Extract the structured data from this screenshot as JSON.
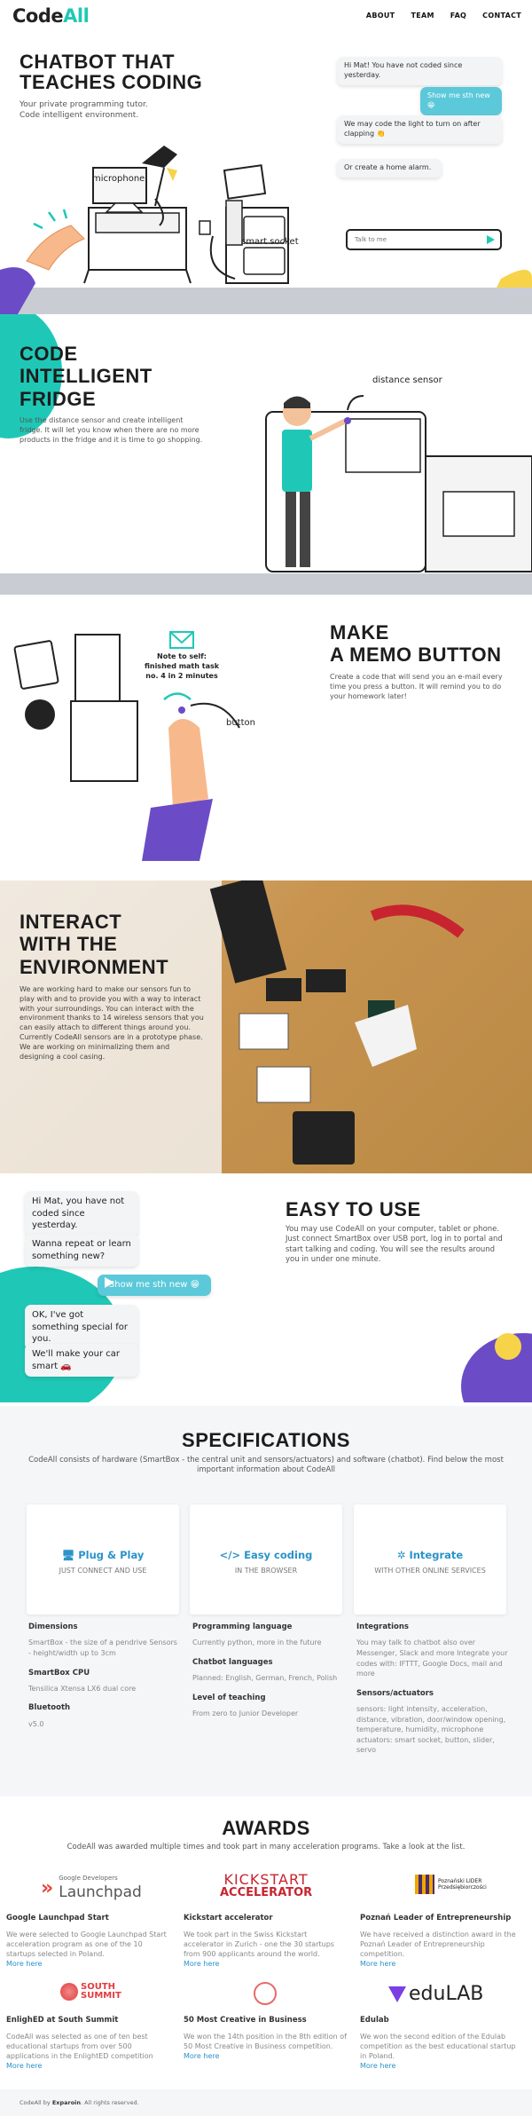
{
  "nav": {
    "logo_code": "Code",
    "logo_all": "All",
    "links": [
      "ABOUT",
      "TEAM",
      "FAQ",
      "CONTACT"
    ]
  },
  "hero": {
    "title_line1": "CHATBOT THAT",
    "title_line2": "TEACHES CODING",
    "sub1": "Your private programming tutor.",
    "sub2": "Code intelligent environment.",
    "chat": [
      {
        "from": "bot",
        "text": "Hi Mat! You have not coded since yesterday."
      },
      {
        "from": "user",
        "text": "Show me sth new 😁"
      },
      {
        "from": "bot",
        "text": "We may code the light to turn on after clapping 👏"
      },
      {
        "from": "bot",
        "text": "Or create a home alarm."
      }
    ],
    "input_placeholder": "Talk to me",
    "label_microphone": "microphone",
    "label_socket": "smart socket"
  },
  "fridge": {
    "title_line1": "CODE",
    "title_line2": "INTELLIGENT",
    "title_line3": "FRIDGE",
    "text": "Use the distance sensor and create intelligent fridge. It will let you know when there are no more products in the fridge and it is time to go shopping.",
    "label_sensor": "distance sensor"
  },
  "memo": {
    "title_line1": "MAKE",
    "title_line2": "A MEMO BUTTON",
    "text": "Create a code that will send you an e-mail every time you press a button. It will remind you to do your homework later!",
    "note": "Note to self: finished math task no. 4 in 2 minutes",
    "label_button": "button"
  },
  "interact": {
    "title_line1": "INTERACT",
    "title_line2": "WITH THE",
    "title_line3": "ENVIRONMENT",
    "text": "We are working hard to make our sensors fun to play with and to provide you with a way to interact with your surroundings. You can interact with the environment thanks to 14 wireless sensors that you can easily attach to different things around you. Currently CodeAll sensors are in a prototype phase. We are working on minimalizing them and designing a cool casing."
  },
  "easy": {
    "title": "EASY TO USE",
    "text": "You may use CodeAll on your computer, tablet or phone. Just connect SmartBox over USB port, log in to portal and start talking and coding. You will see the results around you in under one minute.",
    "chat": [
      "Hi Mat, you have not coded since yesterday.",
      "Wanna repeat or learn something new?",
      "Show me sth new 😁",
      "OK, I've got something special for you.",
      "We'll make your car smart 🚗"
    ]
  },
  "specs": {
    "title": "SPECIFICATIONS",
    "intro": "CodeAll consists of hardware (SmartBox - the central unit and sensors/actuators) and software (chatbot). Find below the most important information about CodeAll",
    "cards": [
      {
        "icon": "monitor-icon",
        "title": "Plug & Play",
        "sub": "JUST CONNECT AND USE"
      },
      {
        "icon": "code-icon",
        "title": "Easy coding",
        "sub": "IN THE BROWSER"
      },
      {
        "icon": "puzzle-icon",
        "title": "Integrate",
        "sub": "WITH OTHER ONLINE SERVICES"
      }
    ],
    "col1": {
      "h1": "Dimensions",
      "p1": "SmartBox - the size of a pendrive Sensors - height/width up to 3cm",
      "h2": "SmartBox CPU",
      "p2": "Tensilica Xtensa LX6 dual core",
      "h3": "Bluetooth",
      "p3": "v5.0"
    },
    "col2": {
      "h1": "Programming language",
      "p1": "Currently python, more in the future",
      "h2": "Chatbot languages",
      "p2": "Planned: English, German, French, Polish",
      "h3": "Level of teaching",
      "p3": "From zero to Junior Developer"
    },
    "col3": {
      "h1": "Integrations",
      "p1": "You may talk to chatbot also over Messenger, Slack and more Integrate your codes with: IFTTT, Google Docs, mail and more",
      "h2": "Sensors/actuators",
      "p2": "sensors: light intensity, acceleration, distance, vibration, door/window opening, temperature, humidity, microphone actuators: smart socket, button, slider, servo"
    }
  },
  "awards": {
    "title": "AWARDS",
    "intro": "CodeAll was awarded multiple times and took part in many acceleration programs. Take a look at the list.",
    "more": "More here",
    "items": [
      {
        "logo_small": "Google Developers",
        "logo_big": "Launchpad",
        "title": "Google Launchpad Start",
        "text": "We were selected to Google Launchpad Start acceleration program as one of the 10 startups selected in Poland."
      },
      {
        "logo_small": "KICKSTART",
        "logo_big": "ACCELERATOR",
        "title": "Kickstart accelerator",
        "text": "We took part in the Swiss Kickstart accelerator in Zurich - one the 30 startups from 900 applicants around the world."
      },
      {
        "logo_small": "Poznański LIDER",
        "logo_big": "Przedsiębiorczości",
        "title": "Poznań Leader of Entrepreneurship",
        "text": "We have received a distinction award in the Poznań Leader of Entrepreneurship competition."
      },
      {
        "logo_small": "SOUTH",
        "logo_big": "SUMMIT",
        "title": "EnlighED at South Summit",
        "text": "CodeAll was selected as one of ten best educational startups from over 500 applications in the EnlightED competition"
      },
      {
        "logo_small": "",
        "logo_big": "",
        "title": "50 Most Creative in Business",
        "text": "We won the 14th position in the 8th edition of 50 Most Creative in Business competition."
      },
      {
        "logo_small": "",
        "logo_big": "eduLAB",
        "title": "Edulab",
        "text": "We won the second edition of the Edulab competition as the best educational startup in Poland."
      }
    ]
  },
  "footer": {
    "pre": "CodeAll by",
    "brand": "Exparoin",
    "post": ". All rights reserved."
  },
  "colors": {
    "accent": "#1fc8b6",
    "link": "#2a93c9",
    "purple": "#6b4cc6",
    "orange": "#f7a25b"
  }
}
